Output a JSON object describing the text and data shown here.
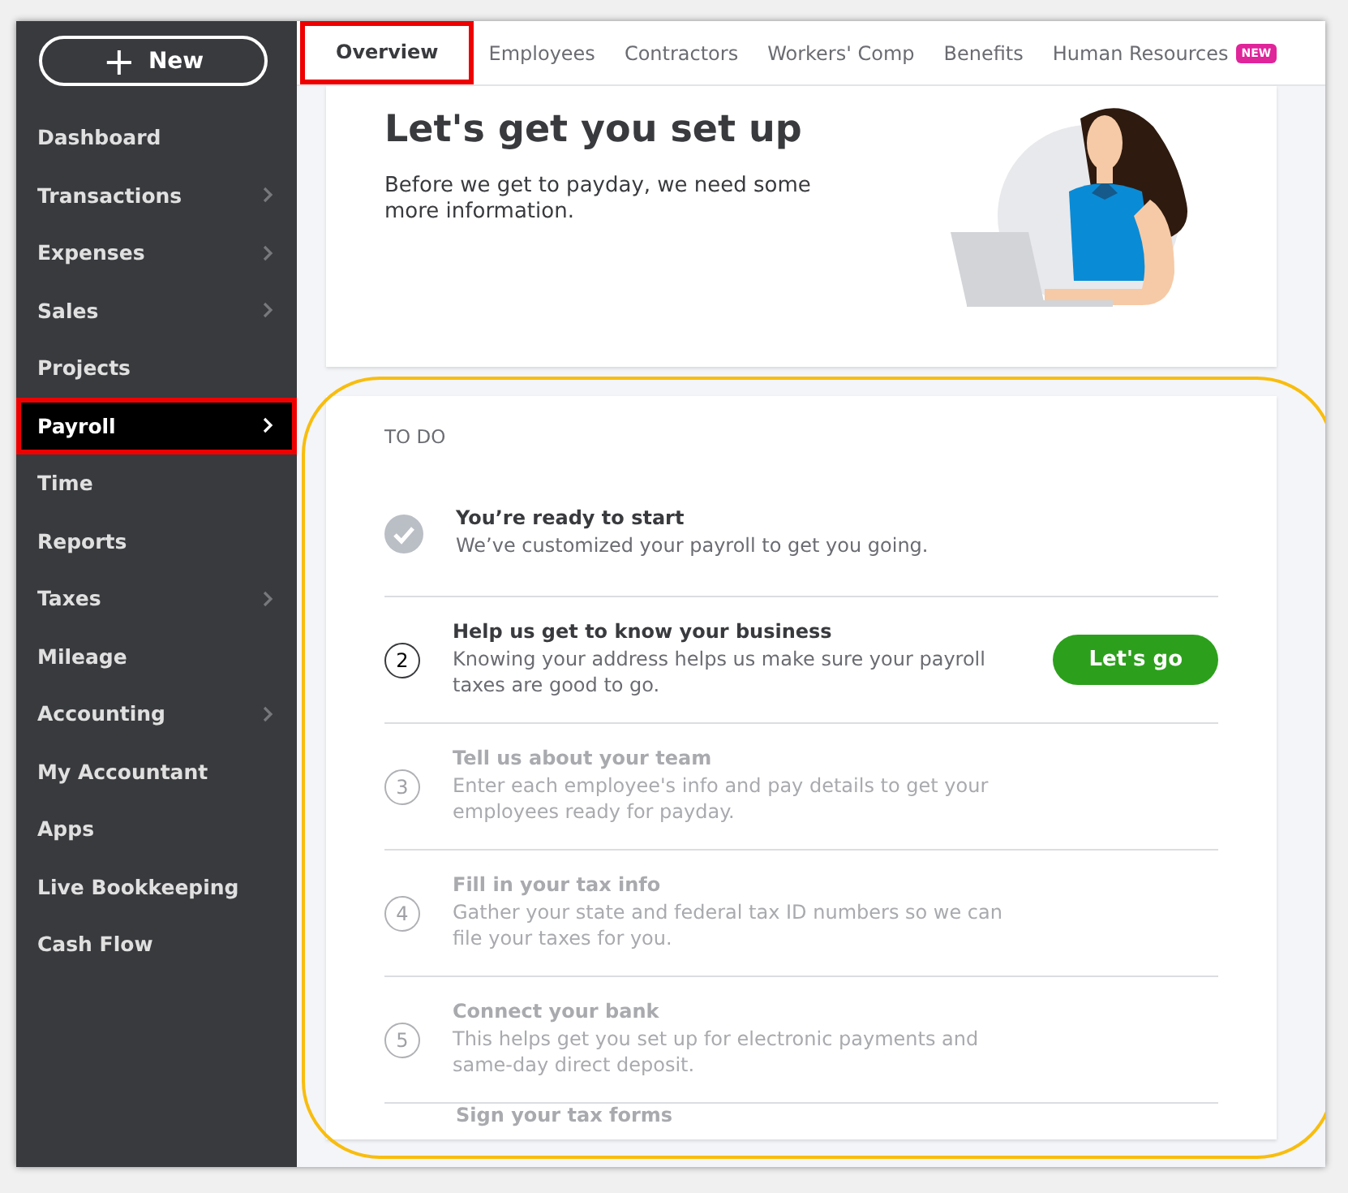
{
  "sidebar": {
    "new_button": {
      "label": "New",
      "icon": "+"
    },
    "items": [
      {
        "label": "Dashboard",
        "has_submenu": false,
        "selected": false,
        "highlighted": false
      },
      {
        "label": "Transactions",
        "has_submenu": true,
        "selected": false,
        "highlighted": false
      },
      {
        "label": "Expenses",
        "has_submenu": true,
        "selected": false,
        "highlighted": false
      },
      {
        "label": "Sales",
        "has_submenu": true,
        "selected": false,
        "highlighted": false
      },
      {
        "label": "Projects",
        "has_submenu": false,
        "selected": false,
        "highlighted": false
      },
      {
        "label": "Payroll",
        "has_submenu": true,
        "selected": true,
        "highlighted": true
      },
      {
        "label": "Time",
        "has_submenu": false,
        "selected": false,
        "highlighted": false
      },
      {
        "label": "Reports",
        "has_submenu": false,
        "selected": false,
        "highlighted": false
      },
      {
        "label": "Taxes",
        "has_submenu": true,
        "selected": false,
        "highlighted": false
      },
      {
        "label": "Mileage",
        "has_submenu": false,
        "selected": false,
        "highlighted": false
      },
      {
        "label": "Accounting",
        "has_submenu": true,
        "selected": false,
        "highlighted": false
      },
      {
        "label": "My Accountant",
        "has_submenu": false,
        "selected": false,
        "highlighted": false
      },
      {
        "label": "Apps",
        "has_submenu": false,
        "selected": false,
        "highlighted": false
      },
      {
        "label": "Live Bookkeeping",
        "has_submenu": false,
        "selected": false,
        "highlighted": false
      },
      {
        "label": "Cash Flow",
        "has_submenu": false,
        "selected": false,
        "highlighted": false
      }
    ]
  },
  "tabs": [
    {
      "label": "Overview",
      "selected": true,
      "highlighted": true
    },
    {
      "label": "Employees",
      "selected": false,
      "highlighted": false
    },
    {
      "label": "Contractors",
      "selected": false,
      "highlighted": false
    },
    {
      "label": "Workers' Comp",
      "selected": false,
      "highlighted": false
    },
    {
      "label": "Benefits",
      "selected": false,
      "highlighted": false
    },
    {
      "label": "Human Resources",
      "selected": false,
      "highlighted": false,
      "badge": "NEW"
    }
  ],
  "setup_card": {
    "title": "Let's get you set up",
    "text": "Before we get to payday, we need some more information."
  },
  "todo": {
    "heading": "TO DO",
    "highlighted": true,
    "items": [
      {
        "kind": "done",
        "title": "You’re ready to start",
        "description": "We’ve customized your payroll to get you going."
      },
      {
        "kind": "active",
        "number": "2",
        "title": "Help us get to know your business",
        "description": "Knowing your address helps us make sure your payroll taxes are good to go.",
        "button": "Let's go"
      },
      {
        "kind": "pending",
        "number": "3",
        "title": "Tell us about your team",
        "description": "Enter each employee's info and pay details to get your employees ready for payday."
      },
      {
        "kind": "pending",
        "number": "4",
        "title": "Fill in your tax info",
        "description": "Gather your state and federal tax ID numbers so we can file your taxes for you."
      },
      {
        "kind": "pending",
        "number": "5",
        "title": "Connect your bank",
        "description": "This helps get you set up for electronic payments and same-day direct deposit."
      },
      {
        "kind": "pending",
        "title": "Sign your tax forms"
      }
    ]
  }
}
